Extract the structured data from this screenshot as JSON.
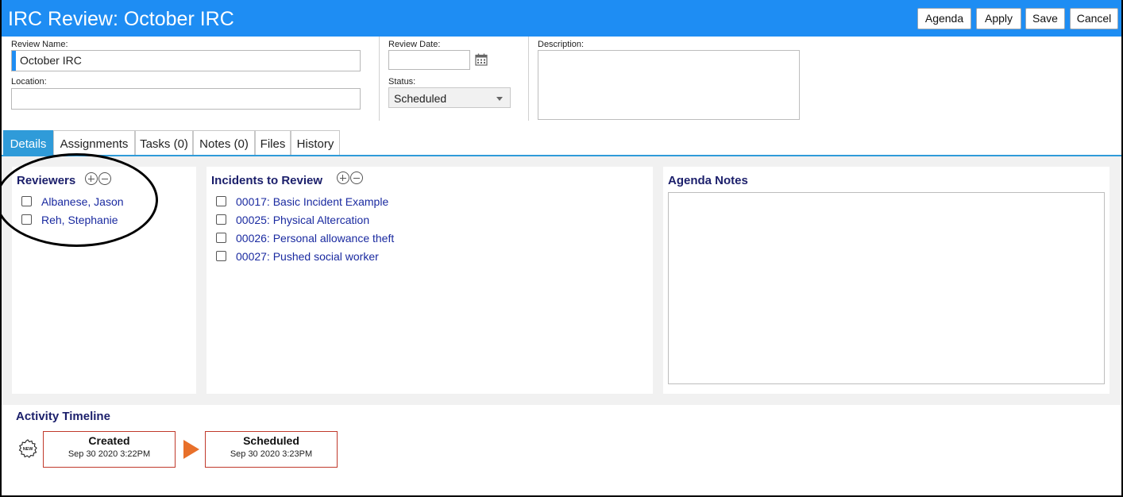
{
  "header": {
    "title": "IRC Review: October IRC",
    "buttons": {
      "agenda": "Agenda",
      "apply": "Apply",
      "save": "Save",
      "cancel": "Cancel"
    },
    "background_color": "#1e8df3"
  },
  "form": {
    "review_name_label": "Review Name:",
    "review_name_value": "October IRC",
    "location_label": "Location:",
    "location_value": "",
    "review_date_label": "Review Date:",
    "review_date_value": "",
    "status_label": "Status:",
    "status_value": "Scheduled",
    "description_label": "Description:",
    "description_value": ""
  },
  "tabs": [
    {
      "label": "Details",
      "active": true
    },
    {
      "label": "Assignments",
      "active": false
    },
    {
      "label": "Tasks (0)",
      "active": false
    },
    {
      "label": "Notes (0)",
      "active": false
    },
    {
      "label": "Files",
      "active": false
    },
    {
      "label": "History",
      "active": false
    }
  ],
  "reviewers": {
    "title": "Reviewers",
    "items": [
      "Albanese, Jason",
      "Reh, Stephanie"
    ]
  },
  "incidents": {
    "title": "Incidents to Review",
    "items": [
      "00017: Basic Incident Example",
      "00025: Physical Altercation",
      "00026: Personal allowance theft",
      "00027: Pushed social worker"
    ]
  },
  "agenda_notes": {
    "title": "Agenda Notes",
    "value": ""
  },
  "timeline": {
    "title": "Activity Timeline",
    "new_badge": "NEW",
    "events": [
      {
        "name": "Created",
        "date": "Sep 30 2020 3:22PM"
      },
      {
        "name": "Scheduled",
        "date": "Sep 30 2020 3:23PM"
      }
    ],
    "arrow_color": "#e8702a",
    "box_border_color": "#c0392b"
  },
  "colors": {
    "accent": "#1e8df3",
    "tab_active": "#2f9bd9",
    "link": "#1a2aa0",
    "heading": "#1b1f6b"
  },
  "icons": [
    "calendar-icon",
    "add-circle-icon",
    "remove-circle-icon",
    "new-badge-icon",
    "chevron-down-icon",
    "arrow-right-icon"
  ]
}
